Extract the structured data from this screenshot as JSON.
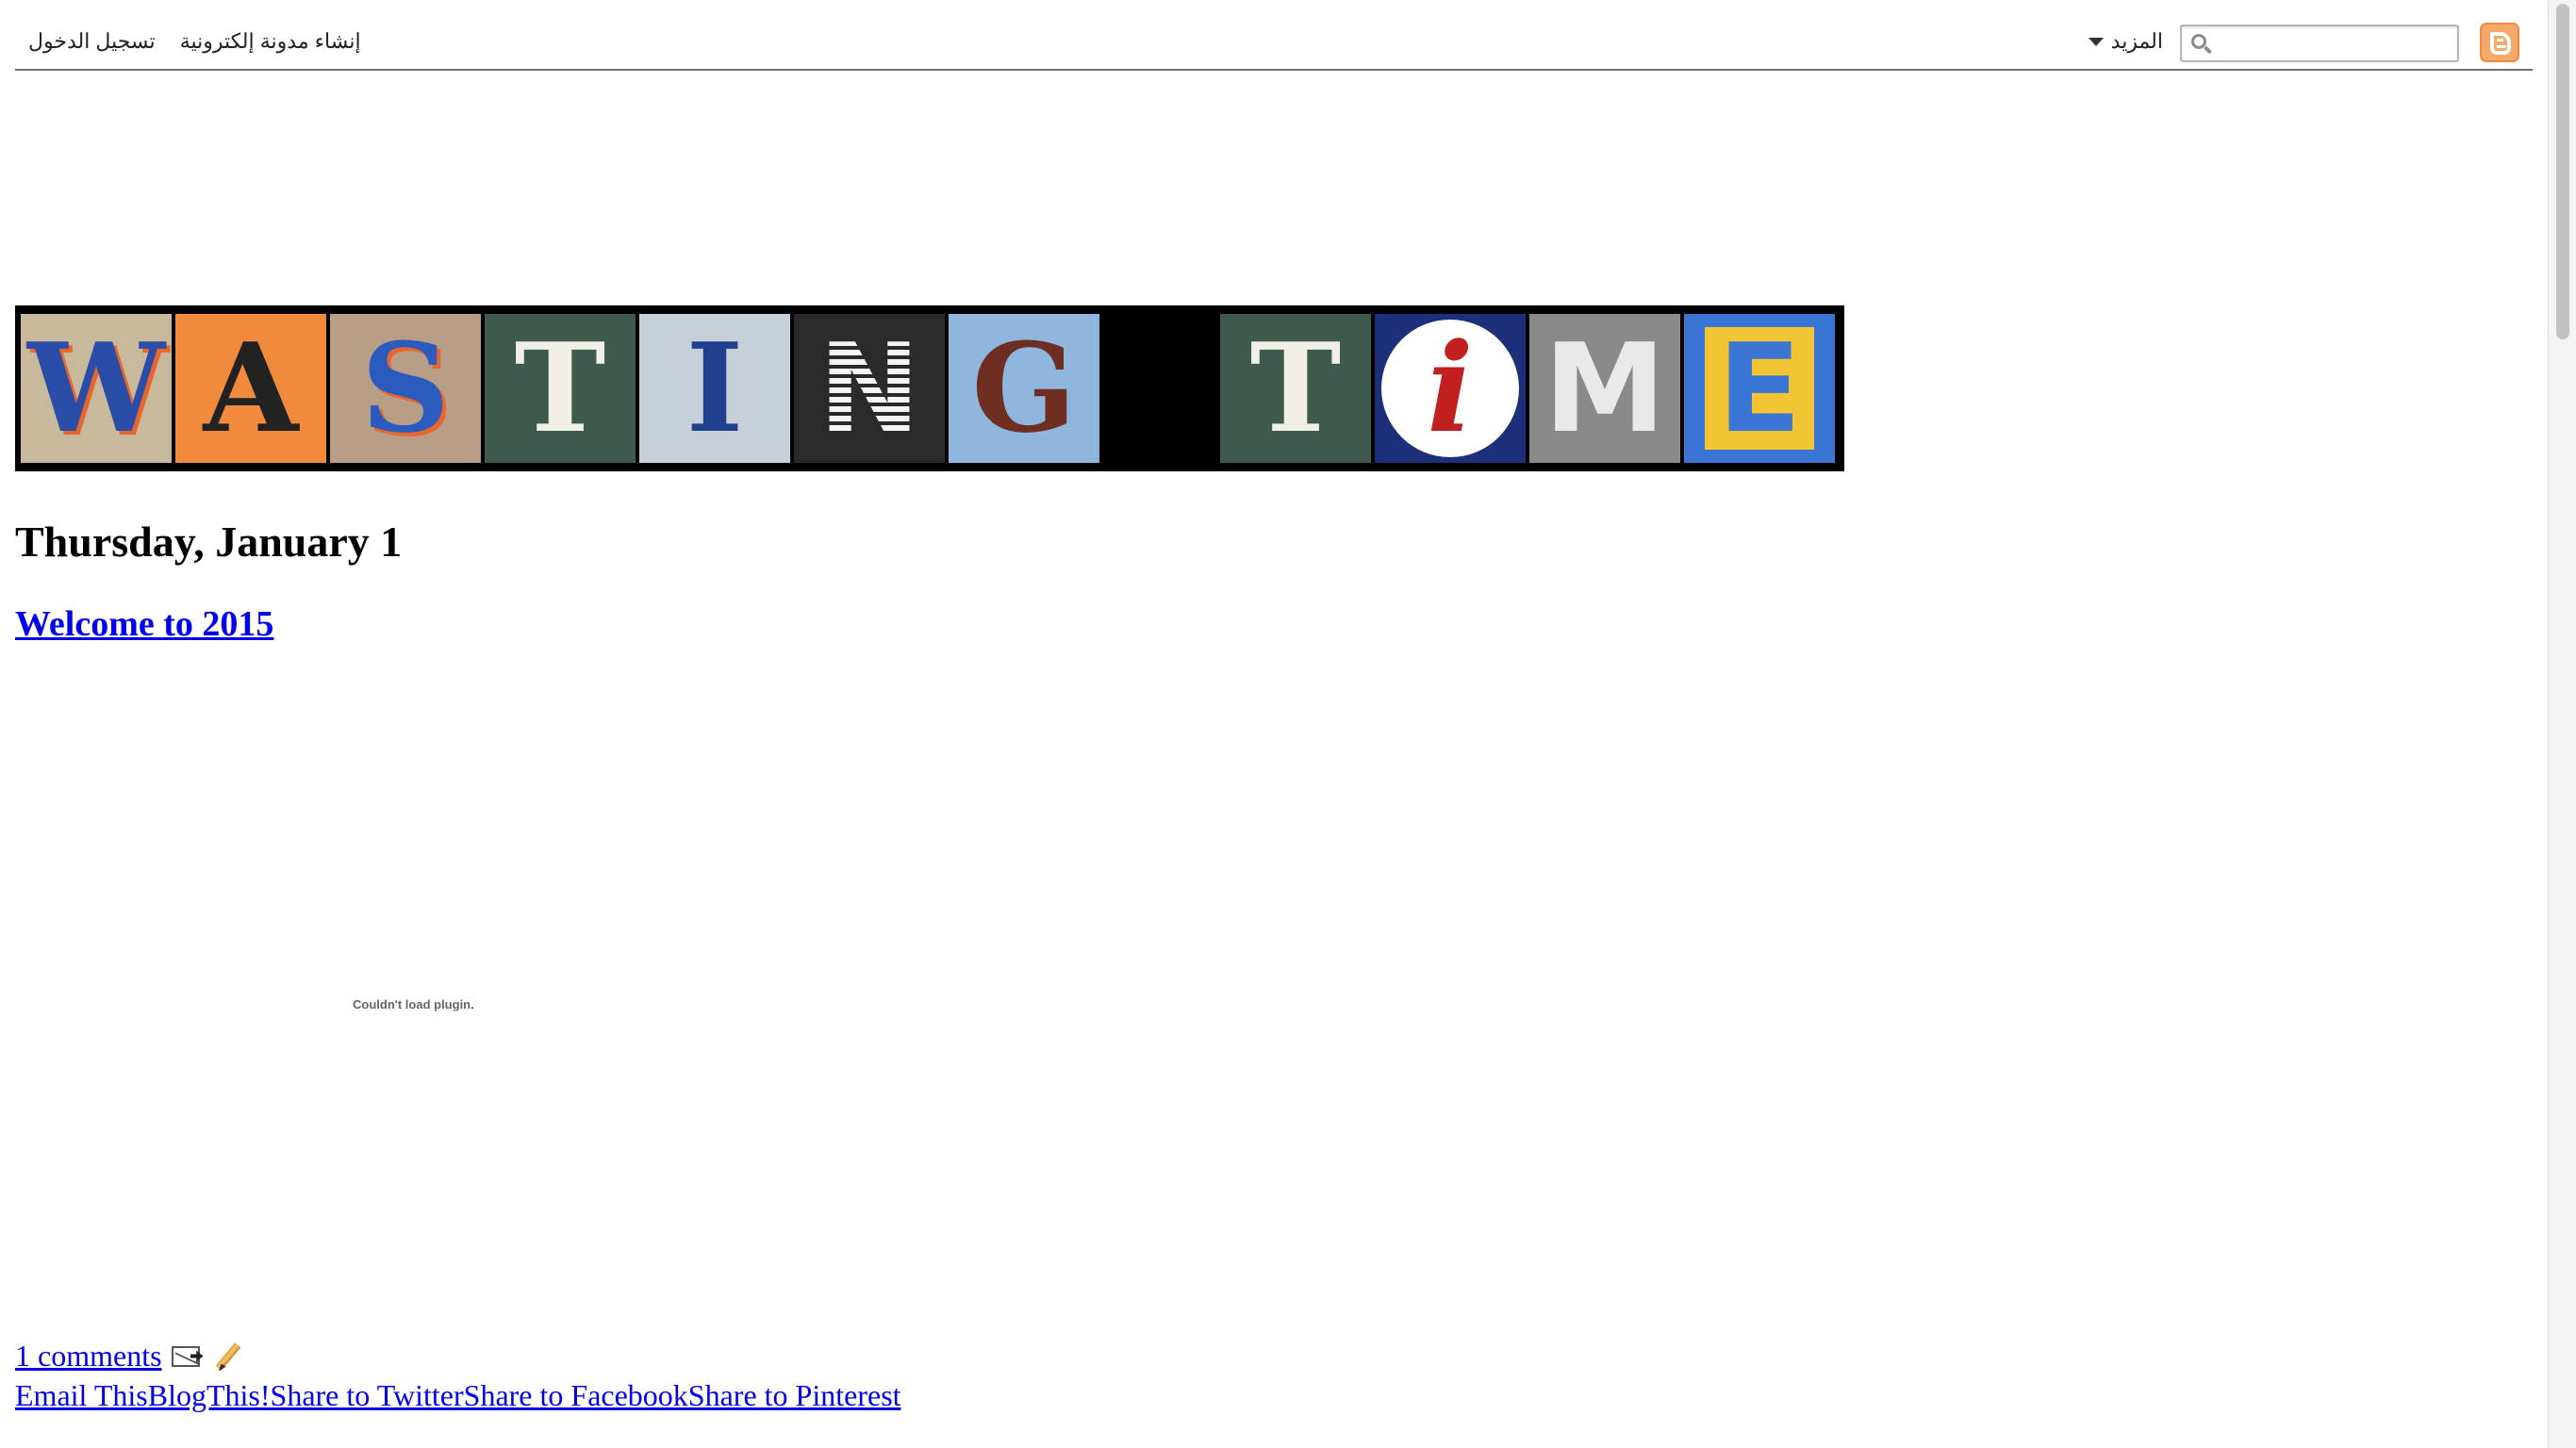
{
  "navbar": {
    "search_placeholder": "",
    "more_label": "المزيد",
    "create_blog_label": "إنشاء مدونة إلكترونية",
    "sign_in_label": "تسجيل الدخول"
  },
  "banner": {
    "letters": [
      {
        "char": "W",
        "bg": "#c9b99c",
        "fg": "#2a4ea8"
      },
      {
        "char": "A",
        "bg": "#f08a3c",
        "fg": "#222222"
      },
      {
        "char": "S",
        "bg": "#b89e86",
        "fg": "#2c5bbf"
      },
      {
        "char": "T",
        "bg": "#3e5a4e",
        "fg": "#f2f0e6"
      },
      {
        "char": "I",
        "bg": "#c7cfd8",
        "fg": "#1f3f8f"
      },
      {
        "char": "N",
        "bg": "#2a2a2a",
        "fg": "#f4f4f4"
      },
      {
        "char": "G",
        "bg": "#8fb7dd",
        "fg": "#6e2e22"
      },
      {
        "char": "",
        "bg": "#000000",
        "fg": "#000000"
      },
      {
        "char": "T",
        "bg": "#3e5a4e",
        "fg": "#f2f0e6"
      },
      {
        "char": "i",
        "bg": "#1d2f78",
        "fg": "#c21f1f"
      },
      {
        "char": "M",
        "bg": "#8a8a8a",
        "fg": "#e9e9e9"
      },
      {
        "char": "E",
        "bg": "#3a75d3",
        "fg": "#f1c533"
      }
    ]
  },
  "post": {
    "date_header": "Thursday, January 1",
    "title": "Welcome to 2015",
    "plugin_message": "Couldn't load plugin.",
    "comments_label": "1 comments",
    "share": {
      "email": "Email This",
      "blogthis": "BlogThis!",
      "twitter": "Share to Twitter",
      "facebook": "Share to Facebook",
      "pinterest": "Share to Pinterest"
    }
  }
}
